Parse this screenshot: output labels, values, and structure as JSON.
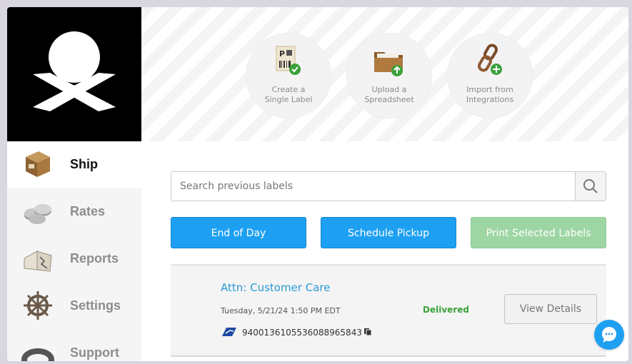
{
  "header": {
    "actions": [
      {
        "line1": "Create a",
        "line2": "Single Label"
      },
      {
        "line1": "Upload a",
        "line2": "Spreadsheet"
      },
      {
        "line1": "Import from",
        "line2": "Integrations"
      }
    ]
  },
  "sidebar": {
    "items": [
      {
        "label": "Ship",
        "icon": "package-box-icon",
        "active": true
      },
      {
        "label": "Rates",
        "icon": "coins-icon"
      },
      {
        "label": "Reports",
        "icon": "book-icon"
      },
      {
        "label": "Settings",
        "icon": "ship-wheel-icon"
      },
      {
        "label": "Support",
        "icon": "life-ring-icon"
      }
    ]
  },
  "search": {
    "placeholder": "Search previous labels"
  },
  "buttons": {
    "end_of_day": "End of Day",
    "schedule_pickup": "Schedule Pickup",
    "print_selected": "Print Selected Labels"
  },
  "shipment": {
    "recipient": "Attn: Customer Care",
    "date": "Tuesday, 5/21/24 1:50 PM EDT",
    "status": "Delivered",
    "tracking": "9400136105536088965843",
    "carrier_icon": "usps-eagle-icon",
    "details_label": "View Details"
  },
  "colors": {
    "accent_blue": "#1ea0f2",
    "disabled_green": "#9ed6a3",
    "status_green": "#3aa13a",
    "link_blue": "#2a9bd6"
  }
}
